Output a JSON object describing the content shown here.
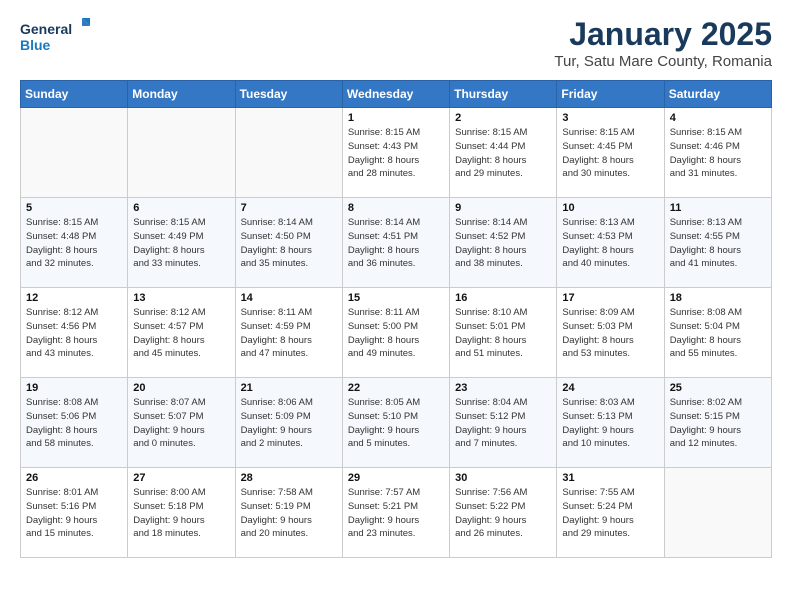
{
  "header": {
    "logo_line1": "General",
    "logo_line2": "Blue",
    "title": "January 2025",
    "subtitle": "Tur, Satu Mare County, Romania"
  },
  "weekdays": [
    "Sunday",
    "Monday",
    "Tuesday",
    "Wednesday",
    "Thursday",
    "Friday",
    "Saturday"
  ],
  "weeks": [
    [
      {
        "day": "",
        "info": ""
      },
      {
        "day": "",
        "info": ""
      },
      {
        "day": "",
        "info": ""
      },
      {
        "day": "1",
        "info": "Sunrise: 8:15 AM\nSunset: 4:43 PM\nDaylight: 8 hours\nand 28 minutes."
      },
      {
        "day": "2",
        "info": "Sunrise: 8:15 AM\nSunset: 4:44 PM\nDaylight: 8 hours\nand 29 minutes."
      },
      {
        "day": "3",
        "info": "Sunrise: 8:15 AM\nSunset: 4:45 PM\nDaylight: 8 hours\nand 30 minutes."
      },
      {
        "day": "4",
        "info": "Sunrise: 8:15 AM\nSunset: 4:46 PM\nDaylight: 8 hours\nand 31 minutes."
      }
    ],
    [
      {
        "day": "5",
        "info": "Sunrise: 8:15 AM\nSunset: 4:48 PM\nDaylight: 8 hours\nand 32 minutes."
      },
      {
        "day": "6",
        "info": "Sunrise: 8:15 AM\nSunset: 4:49 PM\nDaylight: 8 hours\nand 33 minutes."
      },
      {
        "day": "7",
        "info": "Sunrise: 8:14 AM\nSunset: 4:50 PM\nDaylight: 8 hours\nand 35 minutes."
      },
      {
        "day": "8",
        "info": "Sunrise: 8:14 AM\nSunset: 4:51 PM\nDaylight: 8 hours\nand 36 minutes."
      },
      {
        "day": "9",
        "info": "Sunrise: 8:14 AM\nSunset: 4:52 PM\nDaylight: 8 hours\nand 38 minutes."
      },
      {
        "day": "10",
        "info": "Sunrise: 8:13 AM\nSunset: 4:53 PM\nDaylight: 8 hours\nand 40 minutes."
      },
      {
        "day": "11",
        "info": "Sunrise: 8:13 AM\nSunset: 4:55 PM\nDaylight: 8 hours\nand 41 minutes."
      }
    ],
    [
      {
        "day": "12",
        "info": "Sunrise: 8:12 AM\nSunset: 4:56 PM\nDaylight: 8 hours\nand 43 minutes."
      },
      {
        "day": "13",
        "info": "Sunrise: 8:12 AM\nSunset: 4:57 PM\nDaylight: 8 hours\nand 45 minutes."
      },
      {
        "day": "14",
        "info": "Sunrise: 8:11 AM\nSunset: 4:59 PM\nDaylight: 8 hours\nand 47 minutes."
      },
      {
        "day": "15",
        "info": "Sunrise: 8:11 AM\nSunset: 5:00 PM\nDaylight: 8 hours\nand 49 minutes."
      },
      {
        "day": "16",
        "info": "Sunrise: 8:10 AM\nSunset: 5:01 PM\nDaylight: 8 hours\nand 51 minutes."
      },
      {
        "day": "17",
        "info": "Sunrise: 8:09 AM\nSunset: 5:03 PM\nDaylight: 8 hours\nand 53 minutes."
      },
      {
        "day": "18",
        "info": "Sunrise: 8:08 AM\nSunset: 5:04 PM\nDaylight: 8 hours\nand 55 minutes."
      }
    ],
    [
      {
        "day": "19",
        "info": "Sunrise: 8:08 AM\nSunset: 5:06 PM\nDaylight: 8 hours\nand 58 minutes."
      },
      {
        "day": "20",
        "info": "Sunrise: 8:07 AM\nSunset: 5:07 PM\nDaylight: 9 hours\nand 0 minutes."
      },
      {
        "day": "21",
        "info": "Sunrise: 8:06 AM\nSunset: 5:09 PM\nDaylight: 9 hours\nand 2 minutes."
      },
      {
        "day": "22",
        "info": "Sunrise: 8:05 AM\nSunset: 5:10 PM\nDaylight: 9 hours\nand 5 minutes."
      },
      {
        "day": "23",
        "info": "Sunrise: 8:04 AM\nSunset: 5:12 PM\nDaylight: 9 hours\nand 7 minutes."
      },
      {
        "day": "24",
        "info": "Sunrise: 8:03 AM\nSunset: 5:13 PM\nDaylight: 9 hours\nand 10 minutes."
      },
      {
        "day": "25",
        "info": "Sunrise: 8:02 AM\nSunset: 5:15 PM\nDaylight: 9 hours\nand 12 minutes."
      }
    ],
    [
      {
        "day": "26",
        "info": "Sunrise: 8:01 AM\nSunset: 5:16 PM\nDaylight: 9 hours\nand 15 minutes."
      },
      {
        "day": "27",
        "info": "Sunrise: 8:00 AM\nSunset: 5:18 PM\nDaylight: 9 hours\nand 18 minutes."
      },
      {
        "day": "28",
        "info": "Sunrise: 7:58 AM\nSunset: 5:19 PM\nDaylight: 9 hours\nand 20 minutes."
      },
      {
        "day": "29",
        "info": "Sunrise: 7:57 AM\nSunset: 5:21 PM\nDaylight: 9 hours\nand 23 minutes."
      },
      {
        "day": "30",
        "info": "Sunrise: 7:56 AM\nSunset: 5:22 PM\nDaylight: 9 hours\nand 26 minutes."
      },
      {
        "day": "31",
        "info": "Sunrise: 7:55 AM\nSunset: 5:24 PM\nDaylight: 9 hours\nand 29 minutes."
      },
      {
        "day": "",
        "info": ""
      }
    ]
  ]
}
